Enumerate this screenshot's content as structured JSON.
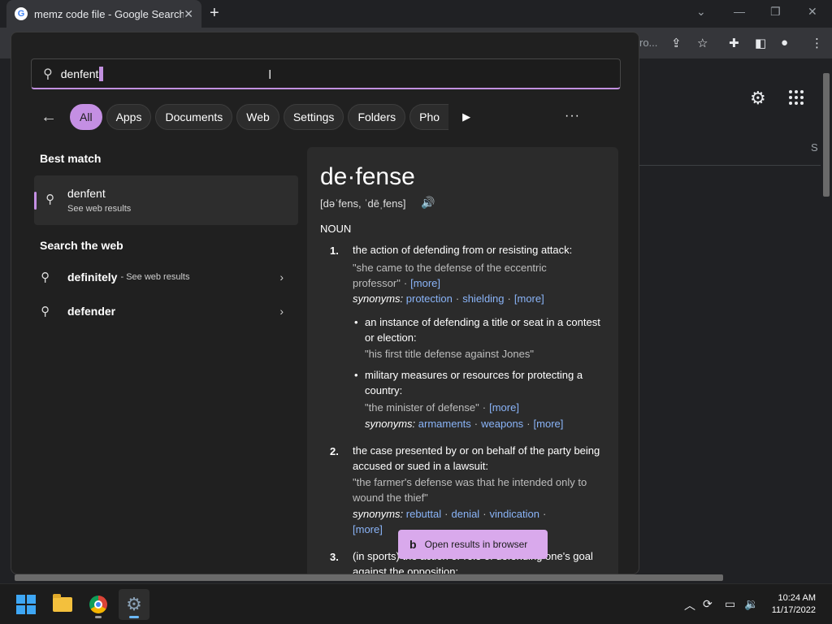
{
  "browser": {
    "tab_title": "memz code file - Google Search",
    "tab_close": "✕",
    "new_tab": "+",
    "url_fragment": "ro...",
    "google_letter": "G",
    "page_cut_letter": "S"
  },
  "search": {
    "query": "denfent",
    "filters": [
      "All",
      "Apps",
      "Documents",
      "Web",
      "Settings",
      "Folders",
      "Pho"
    ],
    "more": "···"
  },
  "best_match": {
    "heading": "Best match",
    "title": "denfent",
    "subtitle": "See web results"
  },
  "search_web": {
    "heading": "Search the web",
    "items": [
      {
        "label": "definitely",
        "sub": "- See web results"
      },
      {
        "label": "defender",
        "sub": ""
      }
    ]
  },
  "dictionary": {
    "word": "de·fense",
    "pronunciation": "[dəˈfens, ˈdēˌfens]",
    "part_of_speech": "NOUN",
    "sense1": {
      "num": "1.",
      "definition": "the action of defending from or resisting attack:",
      "example": "\"she came to the defense of the eccentric professor\"",
      "more": "[more]",
      "synonyms_label": "synonyms:",
      "synonyms": [
        "protection",
        "shielding"
      ],
      "sub": [
        {
          "definition": "an instance of defending a title or seat in a contest or election:",
          "example": "\"his first title defense against Jones\""
        },
        {
          "definition": "military measures or resources for protecting a country:",
          "example": "\"the minister of defense\"",
          "synonyms": [
            "armaments",
            "weapons"
          ]
        }
      ]
    },
    "sense2": {
      "num": "2.",
      "definition": "the case presented by or on behalf of the party being accused or sued in a lawsuit:",
      "example": "\"the farmer's defense was that he intended only to wound the thief\"",
      "synonyms": [
        "rebuttal",
        "denial",
        "vindication"
      ]
    },
    "sense3": {
      "num": "3.",
      "definition": "(in sports) the action or role of defending one's goal against the opposition:"
    }
  },
  "open_browser": "Open results in browser",
  "taskbar": {
    "time": "10:24 AM",
    "date": "11/17/2022"
  },
  "colors": {
    "accent": "#c48fe3",
    "link": "#8ab4f8",
    "panel": "#202020"
  }
}
